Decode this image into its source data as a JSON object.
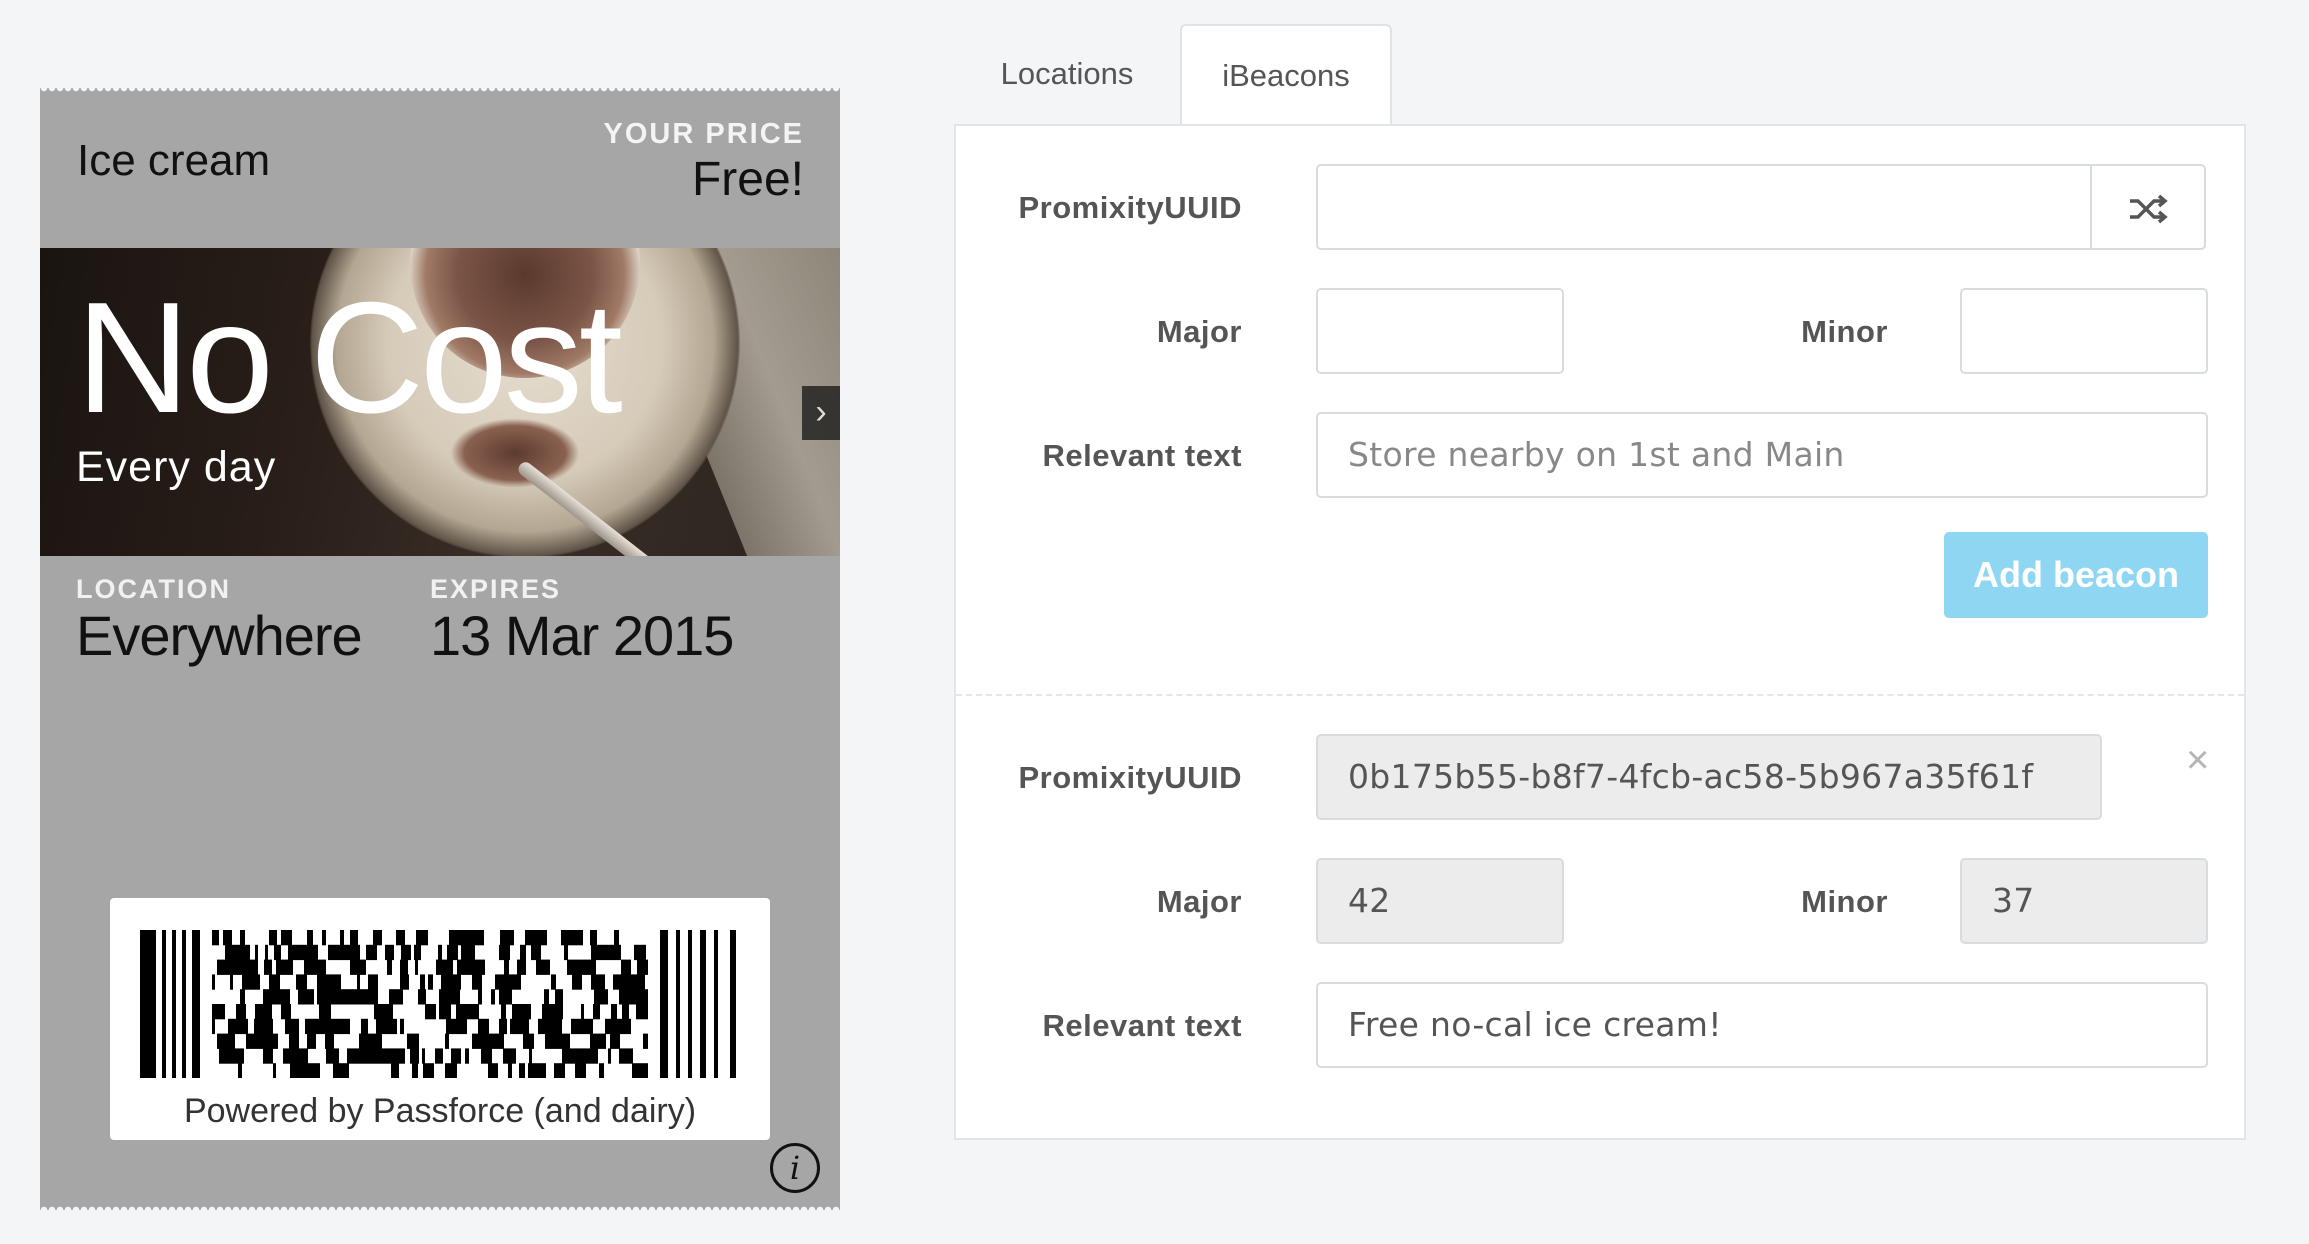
{
  "pass": {
    "title": "Ice cream",
    "price_label": "YOUR PRICE",
    "price_value": "Free!",
    "headline": "No Cost",
    "subheadline": "Every day",
    "location_label": "LOCATION",
    "location_value": "Everywhere",
    "expires_label": "EXPIRES",
    "expires_value": "13 Mar 2015",
    "barcode_caption": "Powered by Passforce (and dairy)",
    "info_glyph": "i",
    "next_glyph": "›"
  },
  "tabs": [
    {
      "label": "Locations",
      "active": false
    },
    {
      "label": "iBeacons",
      "active": true
    }
  ],
  "new_beacon": {
    "uuid_label": "PromixityUUID",
    "uuid_value": "",
    "shuffle_icon": "shuffle-icon",
    "major_label": "Major",
    "major_value": "",
    "minor_label": "Minor",
    "minor_value": "",
    "relevant_label": "Relevant text",
    "relevant_placeholder": "Store nearby on 1st and Main",
    "add_button": "Add beacon"
  },
  "beacons": [
    {
      "uuid_label": "PromixityUUID",
      "uuid_value": "0b175b55-b8f7-4fcb-ac58-5b967a35f61f",
      "major_label": "Major",
      "major_value": "42",
      "minor_label": "Minor",
      "minor_value": "37",
      "relevant_label": "Relevant text",
      "relevant_value": "Free no-cal ice cream!",
      "remove_glyph": "×"
    }
  ],
  "colors": {
    "pass_background": "#a6a6a6",
    "button_accent": "#8fd6f3",
    "readonly_field": "#ececec"
  }
}
